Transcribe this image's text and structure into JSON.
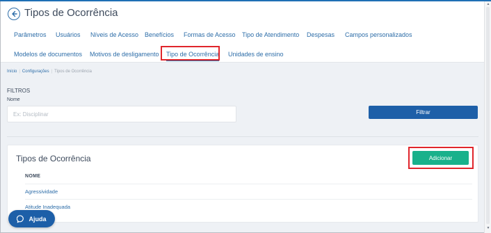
{
  "header": {
    "title": "Tipos de Ocorrência",
    "tabs_row1": [
      "Parâmetros",
      "Usuários",
      "Níveis de Acesso",
      "Benefícios",
      "Formas de Acesso",
      "Tipo de Atendimento",
      "Despesas",
      "Campos personalizados"
    ],
    "tabs_row2": [
      "Modelos de documentos",
      "Motivos de desligamento",
      "Tipo de Ocorrência",
      "Unidades de ensino"
    ],
    "active_tab": "Tipo de Ocorrência"
  },
  "breadcrumb": {
    "items": [
      "Início",
      "Configurações",
      "Tipos de Ocorrência"
    ]
  },
  "filters": {
    "section_label": "FILTROS",
    "name_label": "Nome",
    "name_placeholder": "Ex: Disciplinar",
    "name_value": "",
    "filter_button": "Filtrar"
  },
  "list": {
    "title": "Tipos de Ocorrência",
    "add_button": "Adicionar",
    "column_header": "NOME",
    "rows": [
      "Agressividade",
      "Atitude Inadequada"
    ]
  },
  "help": {
    "label": "Ajuda"
  },
  "colors": {
    "primary": "#1d5fa8",
    "link": "#2d6da8",
    "add_button": "#19b18b",
    "highlight": "#e0252b",
    "background": "#eef1f5"
  }
}
